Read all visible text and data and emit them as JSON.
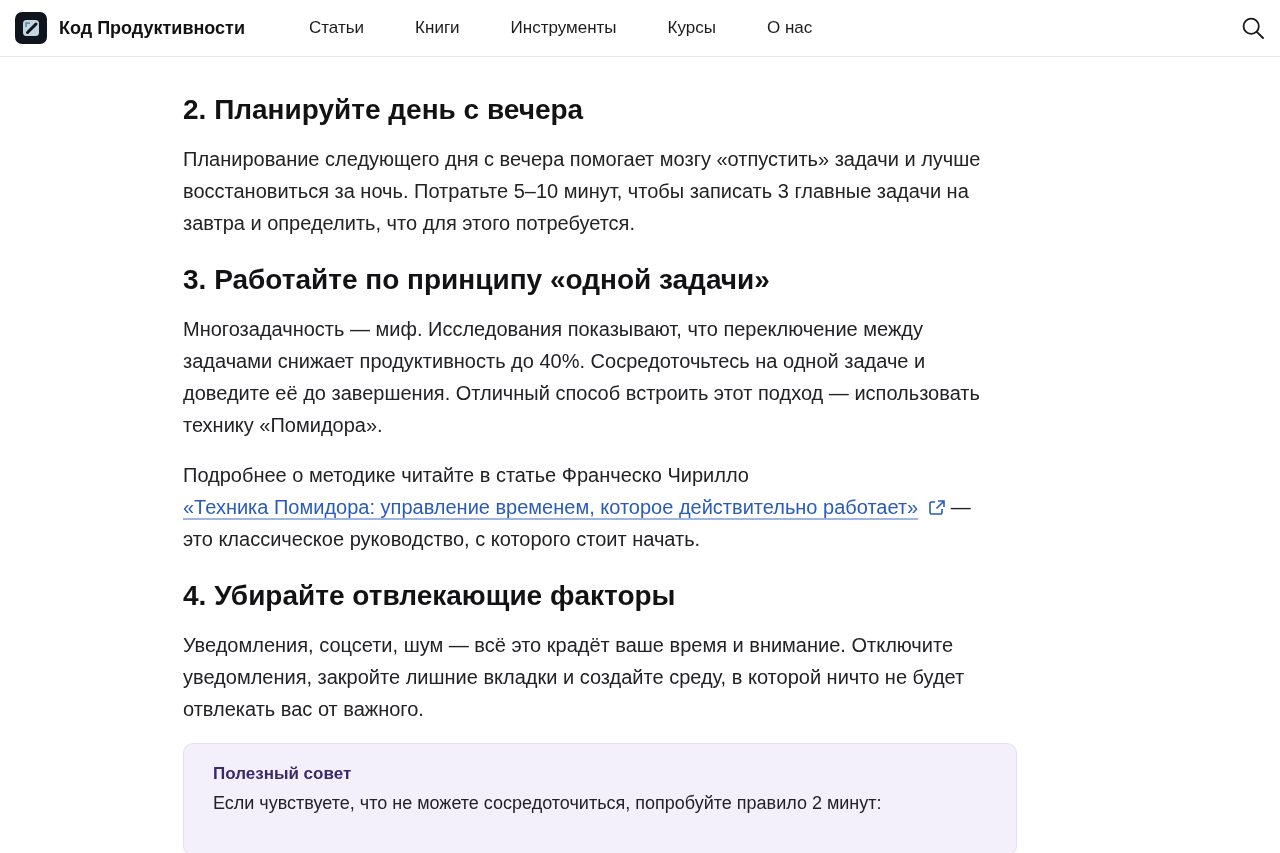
{
  "header": {
    "brand": "Код Продуктивности",
    "nav": [
      {
        "label": "Статьи"
      },
      {
        "label": "Книги"
      },
      {
        "label": "Инструменты"
      },
      {
        "label": "Курсы"
      },
      {
        "label": "О нас"
      }
    ]
  },
  "sections": [
    {
      "heading": "2. Планируйте день с вечера",
      "paragraphs": [
        {
          "text": "Планирование следующего дня с вечера помогает мозгу «отпустить» задачи и лучше восстановиться за ночь. Потратьте 5–10 минут, чтобы записать 3 главные задачи на завтра и определить, что для этого потребуется."
        }
      ]
    },
    {
      "heading": "3. Работайте по принципу «одной задачи»",
      "paragraphs": [
        {
          "text": "Многозадачность — миф. Исследования показывают, что переключение между задачами снижает продуктивность до 40%. Сосредоточьтесь на одной задаче и доведите её до завершения. Отличный способ встроить этот подход — использовать технику «Помидора»."
        },
        {
          "text": "Подробнее о методике читайте в статье Франческо Чирилло",
          "link": "«Техника Помидора: управление временем, которое действительно работает»",
          "after": "— это классическое руководство, с которого стоит начать."
        }
      ]
    },
    {
      "heading": "4. Убирайте отвлекающие факторы",
      "paragraphs": [
        {
          "text": "Уведомления, соцсети, шум — всё это крадёт ваше время и внимание. Отключите уведомления, закройте лишние вкладки и создайте среду, в которой ничто не будет отвлекать вас от важного."
        }
      ]
    }
  ],
  "tip": {
    "title": "Полезный совет",
    "text": "Если чувствуете, что не можете сосредоточиться, попробуйте правило 2 минут:"
  }
}
